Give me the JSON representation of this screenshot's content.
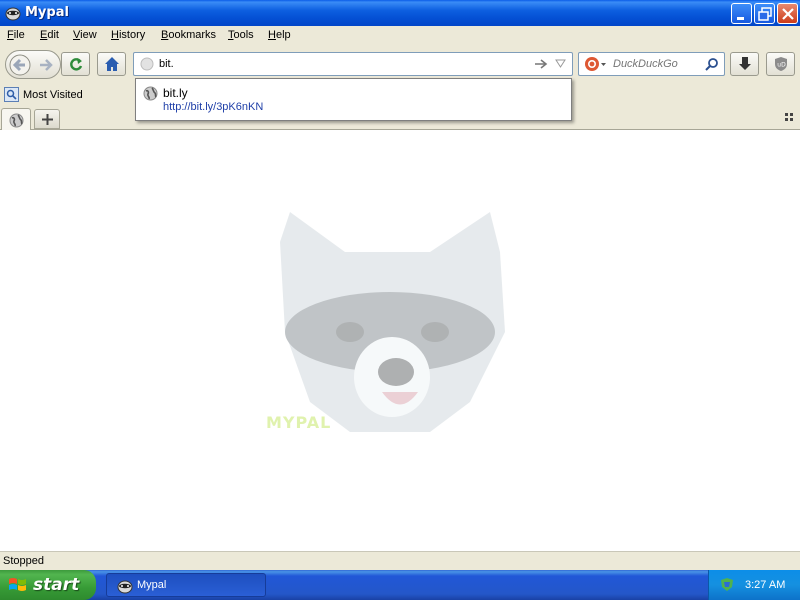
{
  "window": {
    "title": "Mypal"
  },
  "menu": {
    "items": [
      {
        "label": "File",
        "u": "F",
        "rest": "ile"
      },
      {
        "label": "Edit",
        "u": "E",
        "rest": "dit"
      },
      {
        "label": "View",
        "u": "V",
        "rest": "iew"
      },
      {
        "label": "History",
        "u": "H",
        "rest": "istory"
      },
      {
        "label": "Bookmarks",
        "u": "B",
        "rest": "ookmarks"
      },
      {
        "label": "Tools",
        "u": "T",
        "rest": "ools"
      },
      {
        "label": "Help",
        "u": "H",
        "rest": "elp"
      }
    ]
  },
  "urlbar": {
    "value": "bit."
  },
  "search": {
    "placeholder": "DuckDuckGo"
  },
  "bookmarks": {
    "most_visited": "Most Visited"
  },
  "autocomplete": {
    "title": "bit.ly",
    "url": "http://bit.ly/3pK6nKN"
  },
  "content": {
    "watermark_text": "MYPAL"
  },
  "status": {
    "text": "Stopped"
  },
  "taskbar": {
    "start_label": "start",
    "task_label": "Mypal",
    "clock": "3:27 AM"
  },
  "colors": {
    "titlebar": "#0a5ce8",
    "taskbar": "#2457c9",
    "start": "#379b36"
  }
}
